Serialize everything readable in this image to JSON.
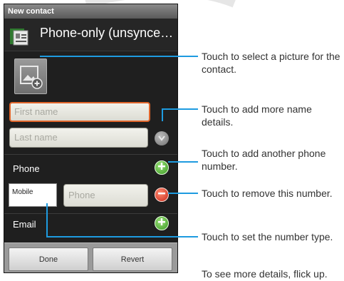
{
  "screen": {
    "title": "New contact",
    "account_name": "Phone-only (unsynce…",
    "first_name_placeholder": "First name",
    "last_name_placeholder": "Last name",
    "phone_section_label": "Phone",
    "phone_type_value": "Mobile",
    "phone_placeholder": "Phone",
    "email_section_label": "Email",
    "done_label": "Done",
    "revert_label": "Revert"
  },
  "callouts": {
    "picture": "Touch to select a picture for the contact.",
    "name_details": "Touch to add more name details.",
    "add_phone": "Touch to add another phone number.",
    "remove_number": "Touch to remove this number.",
    "number_type": "Touch to set the number type.",
    "flick_up": "To see more details, flick up."
  },
  "icons": {
    "account": "contact-card-icon",
    "photo": "picture-add-icon",
    "expand": "chevron-down-icon",
    "add": "plus-icon",
    "remove": "minus-icon"
  },
  "colors": {
    "callout_line": "#1e9be0",
    "focus_border": "#e0652a",
    "add_green": "#3a9a22",
    "remove_red": "#c92a1a"
  }
}
